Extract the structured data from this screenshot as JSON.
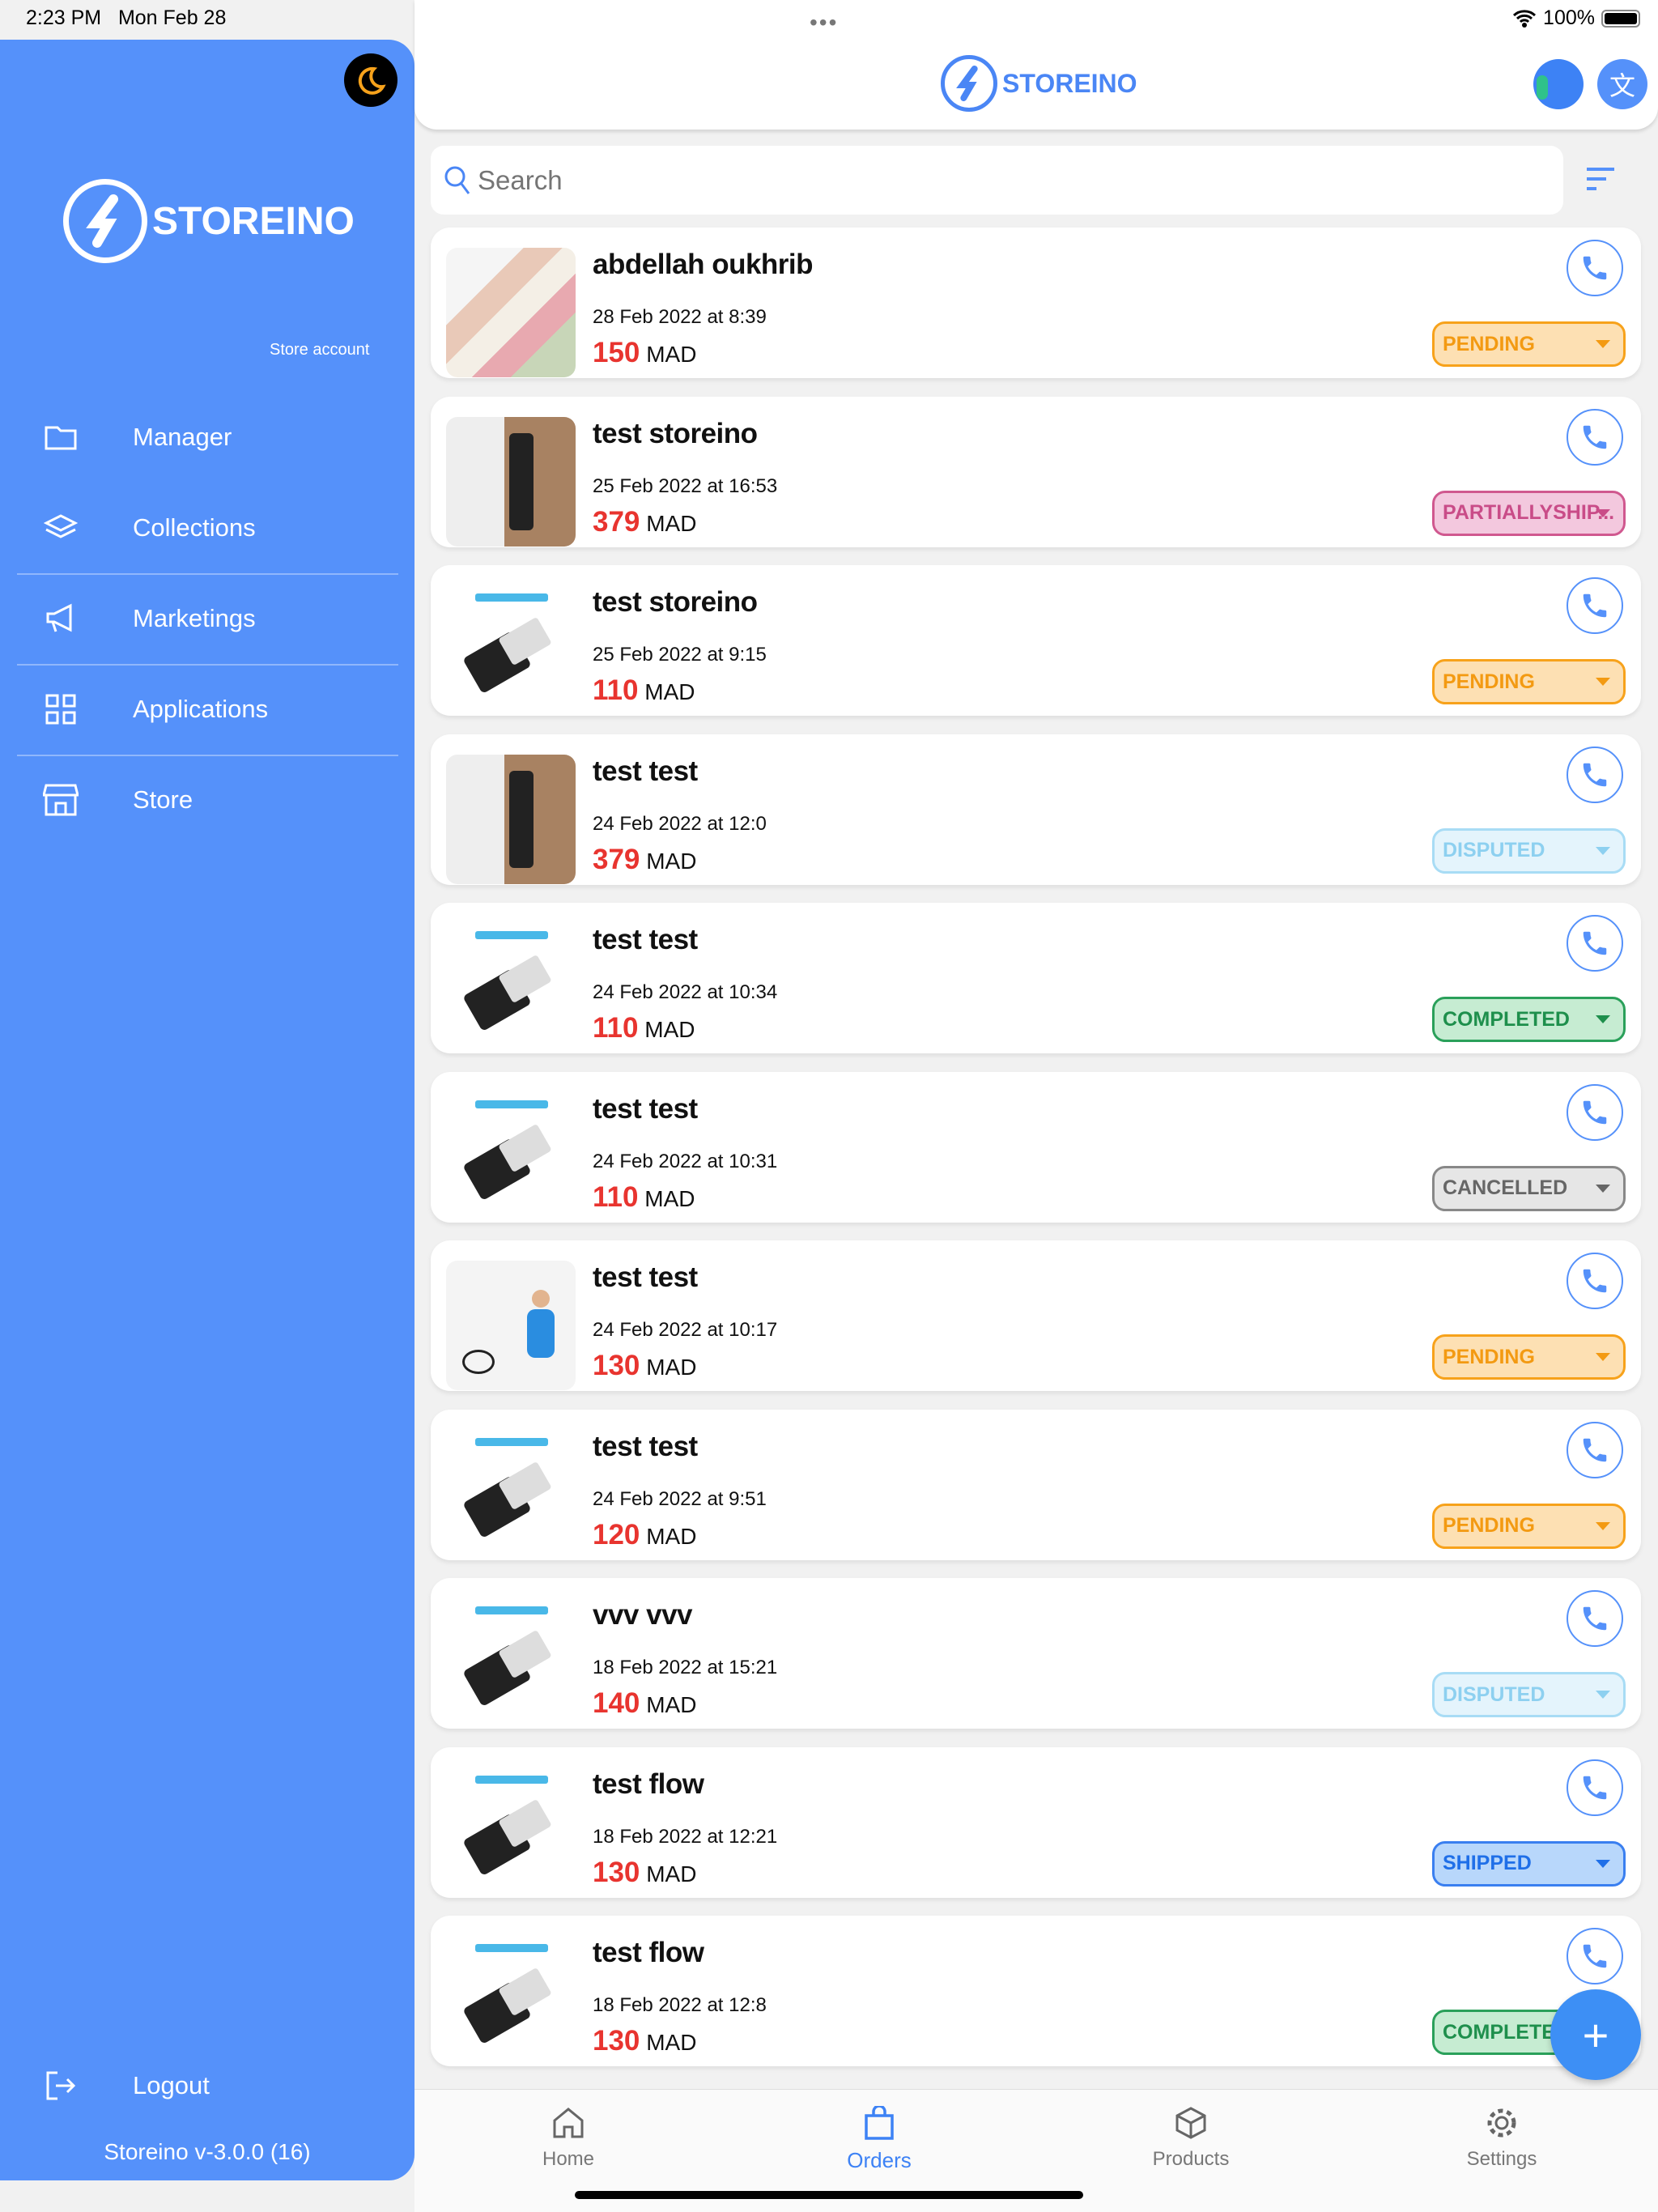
{
  "status_bar": {
    "time": "2:23 PM",
    "date": "Mon Feb 28",
    "battery": "100%"
  },
  "brand": {
    "name": "STOREINO",
    "accent": "#5591fa"
  },
  "sidebar": {
    "store_account": "Store account",
    "items": [
      {
        "label": "Manager",
        "icon": "folder-icon"
      },
      {
        "label": "Collections",
        "icon": "layers-icon"
      },
      {
        "label": "Marketings",
        "icon": "megaphone-icon"
      },
      {
        "label": "Applications",
        "icon": "grid-icon"
      },
      {
        "label": "Store",
        "icon": "store-icon"
      }
    ],
    "logout": "Logout",
    "version": "Storeino v-3.0.0 (16)"
  },
  "search": {
    "placeholder": "Search"
  },
  "status_colors": {
    "PENDING": {
      "bg": "#fde0b3",
      "border": "#f7a21b",
      "text": "#f39a12"
    },
    "PARTIALLYSHIP...": {
      "bg": "#f3c8de",
      "border": "#d0588f",
      "text": "#c94c88"
    },
    "DISPUTED": {
      "bg": "#e4f4fc",
      "border": "#a8dcf5",
      "text": "#8dd0f0"
    },
    "COMPLETED": {
      "bg": "#c6ecd2",
      "border": "#2aa05a",
      "text": "#1e8f4c"
    },
    "CANCELLED": {
      "bg": "#e6e6e6",
      "border": "#888888",
      "text": "#666666"
    },
    "SHIPPED": {
      "bg": "#b8d7fb",
      "border": "#3a7ff0",
      "text": "#1f6fe8"
    }
  },
  "orders": [
    {
      "name": "abdellah oukhrib",
      "date": "28 Feb 2022 at 8:39",
      "amount": "150",
      "currency": "MAD",
      "status": "PENDING",
      "image": "towels"
    },
    {
      "name": "test storeino",
      "date": "25 Feb 2022 at 16:53",
      "amount": "379",
      "currency": "MAD",
      "status": "PARTIALLYSHIP...",
      "image": "door-lock"
    },
    {
      "name": "test storeino",
      "date": "25 Feb 2022 at 9:15",
      "amount": "110",
      "currency": "MAD",
      "status": "PENDING",
      "image": "usb-dongle"
    },
    {
      "name": "test test",
      "date": "24 Feb 2022 at 12:0",
      "amount": "379",
      "currency": "MAD",
      "status": "DISPUTED",
      "image": "door-lock"
    },
    {
      "name": "test test",
      "date": "24 Feb 2022 at 10:34",
      "amount": "110",
      "currency": "MAD",
      "status": "COMPLETED",
      "image": "usb-dongle"
    },
    {
      "name": "test test",
      "date": "24 Feb 2022 at 10:31",
      "amount": "110",
      "currency": "MAD",
      "status": "CANCELLED",
      "image": "usb-dongle"
    },
    {
      "name": "test test",
      "date": "24 Feb 2022 at 10:17",
      "amount": "130",
      "currency": "MAD",
      "status": "PENDING",
      "image": "door-anchor"
    },
    {
      "name": "test test",
      "date": "24 Feb 2022 at 9:51",
      "amount": "120",
      "currency": "MAD",
      "status": "PENDING",
      "image": "usb-dongle"
    },
    {
      "name": "vvv vvv",
      "date": "18 Feb 2022 at 15:21",
      "amount": "140",
      "currency": "MAD",
      "status": "DISPUTED",
      "image": "usb-dongle"
    },
    {
      "name": "test flow",
      "date": "18 Feb 2022 at 12:21",
      "amount": "130",
      "currency": "MAD",
      "status": "SHIPPED",
      "image": "usb-dongle"
    },
    {
      "name": "test flow",
      "date": "18 Feb 2022 at 12:8",
      "amount": "130",
      "currency": "MAD",
      "status": "COMPLETED",
      "image": "usb-dongle"
    }
  ],
  "tabs": [
    {
      "label": "Home",
      "icon": "home-icon"
    },
    {
      "label": "Orders",
      "icon": "shopping-bag-icon",
      "active": true
    },
    {
      "label": "Products",
      "icon": "box-icon"
    },
    {
      "label": "Settings",
      "icon": "gear-icon"
    }
  ]
}
